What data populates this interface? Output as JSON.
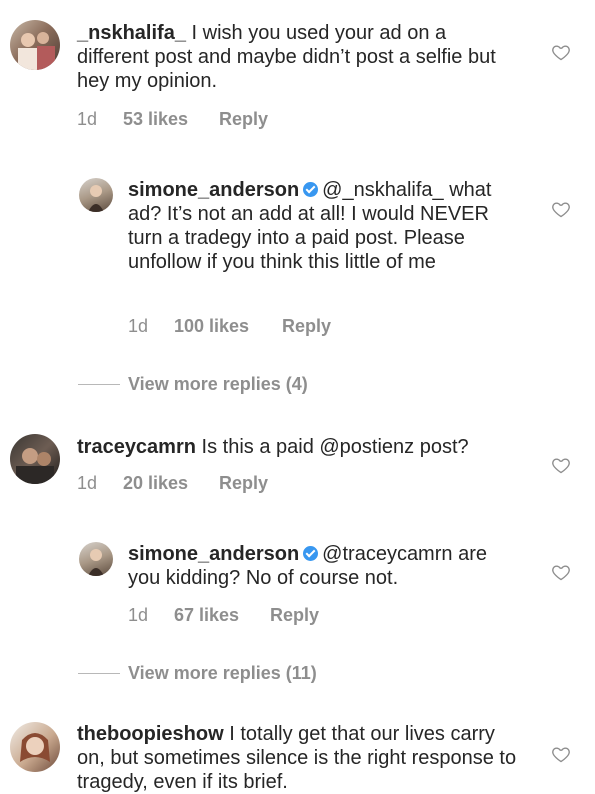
{
  "comments": [
    {
      "username": "_nskhalifa_",
      "text": "I wish you used your ad on a different post and maybe didn’t post a selfie but hey my opinion.",
      "time": "1d",
      "likes": "53 likes",
      "reply": "Reply"
    },
    {
      "username": "simone_anderson",
      "mention": "@_nskhalifa_",
      "text": "what ad? It’s not an add at all! I would NEVER turn a tradegy into a paid post. Please unfollow if you think this little of me",
      "time": "1d",
      "likes": "100 likes",
      "reply": "Reply"
    },
    {
      "username": "traceycamrn",
      "text": "Is this a paid @postienz post?",
      "time": "1d",
      "likes": "20 likes",
      "reply": "Reply"
    },
    {
      "username": "simone_anderson",
      "mention": "@traceycamrn",
      "text": "are you kidding? No of course not.",
      "time": "1d",
      "likes": "67 likes",
      "reply": "Reply"
    },
    {
      "username": "theboopieshow",
      "text": "I totally get that our lives carry on, but sometimes silence is the right response to tragedy, even if its brief."
    }
  ],
  "view_more": [
    "View more replies (4)",
    "View more replies (11)"
  ],
  "colors": {
    "text": "#262626",
    "meta": "#8e8e8e",
    "verified": "#3897f0"
  },
  "icons": [
    "heart-outline-icon",
    "verified-badge-icon"
  ]
}
